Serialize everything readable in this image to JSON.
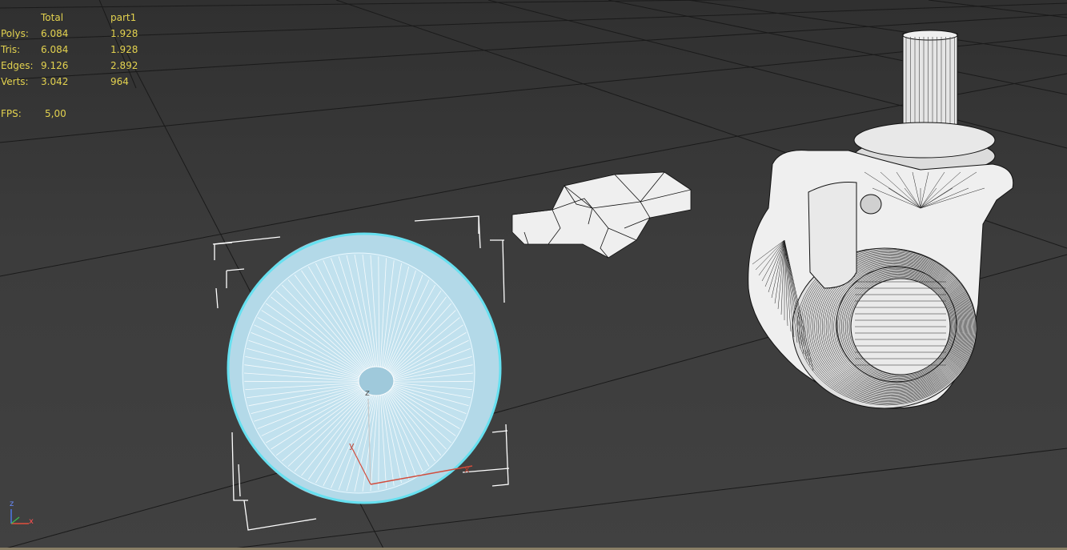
{
  "stats": {
    "header": {
      "col_total": "Total",
      "col_part": "part1"
    },
    "rows": [
      {
        "label": "Polys:",
        "total": "6.084",
        "part": "1.928"
      },
      {
        "label": "Tris:",
        "total": "6.084",
        "part": "1.928"
      },
      {
        "label": "Edges:",
        "total": "9.126",
        "part": "2.892"
      },
      {
        "label": "Verts:",
        "total": "3.042",
        "part": "964"
      }
    ],
    "fps": {
      "label": "FPS:",
      "value": "5,00"
    }
  },
  "gizmo": {
    "z": "z",
    "y": "y",
    "x": "x"
  },
  "axis_tripod": {
    "z": "z",
    "x": "x"
  },
  "colors": {
    "stats_text": "#e3d24f",
    "grid": "#1a1a1a",
    "selection": "#a9d7ea",
    "selection_outline": "#66e0f0",
    "mesh_fill": "#efefef",
    "mesh_wire": "#111111",
    "bbox": "#ffffff",
    "axis_x": "#e0503c",
    "axis_y": "#d24c3c",
    "axis_z": "#4e78e8"
  }
}
